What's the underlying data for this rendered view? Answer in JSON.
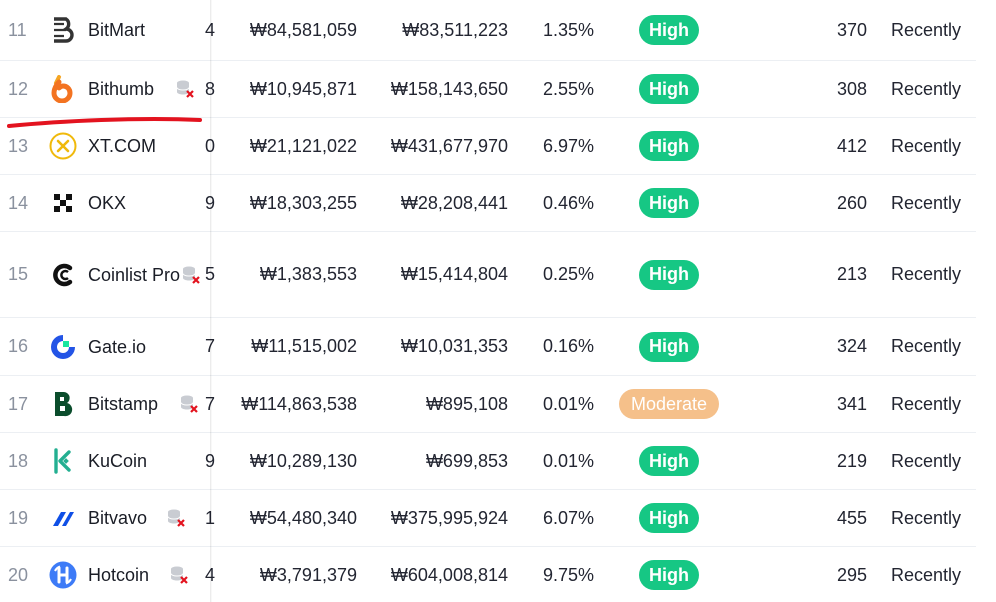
{
  "colors": {
    "high": "#16c784",
    "moderate": "#f5c08a",
    "annotation": "#e3131f"
  },
  "rows": [
    {
      "rank": "11",
      "name": "BitMart",
      "logo": "bitmart-logo-icon",
      "unverified": false,
      "cut": "4",
      "volume": "₩84,581,059",
      "depth": "₩83,511,223",
      "percent": "1.35%",
      "liquidity": "High",
      "markets": "370",
      "updated": "Recently"
    },
    {
      "rank": "12",
      "name": "Bithumb",
      "logo": "bithumb-logo-icon",
      "unverified": true,
      "cut": "8",
      "volume": "₩10,945,871",
      "depth": "₩158,143,650",
      "percent": "2.55%",
      "liquidity": "High",
      "markets": "308",
      "updated": "Recently"
    },
    {
      "rank": "13",
      "name": "XT.COM",
      "logo": "xtcom-logo-icon",
      "unverified": false,
      "cut": "0",
      "volume": "₩21,121,022",
      "depth": "₩431,677,970",
      "percent": "6.97%",
      "liquidity": "High",
      "markets": "412",
      "updated": "Recently"
    },
    {
      "rank": "14",
      "name": "OKX",
      "logo": "okx-logo-icon",
      "unverified": false,
      "cut": "9",
      "volume": "₩18,303,255",
      "depth": "₩28,208,441",
      "percent": "0.46%",
      "liquidity": "High",
      "markets": "260",
      "updated": "Recently"
    },
    {
      "rank": "15",
      "name": "Coinlist Pro",
      "logo": "coinlist-logo-icon",
      "unverified": true,
      "cut": "5",
      "volume": "₩1,383,553",
      "depth": "₩15,414,804",
      "percent": "0.25%",
      "liquidity": "High",
      "markets": "213",
      "updated": "Recently"
    },
    {
      "rank": "16",
      "name": "Gate.io",
      "logo": "gateio-logo-icon",
      "unverified": false,
      "cut": "7",
      "volume": "₩11,515,002",
      "depth": "₩10,031,353",
      "percent": "0.16%",
      "liquidity": "High",
      "markets": "324",
      "updated": "Recently"
    },
    {
      "rank": "17",
      "name": "Bitstamp",
      "logo": "bitstamp-logo-icon",
      "unverified": true,
      "cut": "7",
      "volume": "₩114,863,538",
      "depth": "₩895,108",
      "percent": "0.01%",
      "liquidity": "Moderate",
      "markets": "341",
      "updated": "Recently"
    },
    {
      "rank": "18",
      "name": "KuCoin",
      "logo": "kucoin-logo-icon",
      "unverified": false,
      "cut": "9",
      "volume": "₩10,289,130",
      "depth": "₩699,853",
      "percent": "0.01%",
      "liquidity": "High",
      "markets": "219",
      "updated": "Recently"
    },
    {
      "rank": "19",
      "name": "Bitvavo",
      "logo": "bitvavo-logo-icon",
      "unverified": true,
      "cut": "1",
      "volume": "₩54,480,340",
      "depth": "₩375,995,924",
      "percent": "6.07%",
      "liquidity": "High",
      "markets": "455",
      "updated": "Recently"
    },
    {
      "rank": "20",
      "name": "Hotcoin",
      "logo": "hotcoin-logo-icon",
      "unverified": true,
      "cut": "4",
      "volume": "₩3,791,379",
      "depth": "₩604,008,814",
      "percent": "9.75%",
      "liquidity": "High",
      "markets": "295",
      "updated": "Recently"
    }
  ]
}
